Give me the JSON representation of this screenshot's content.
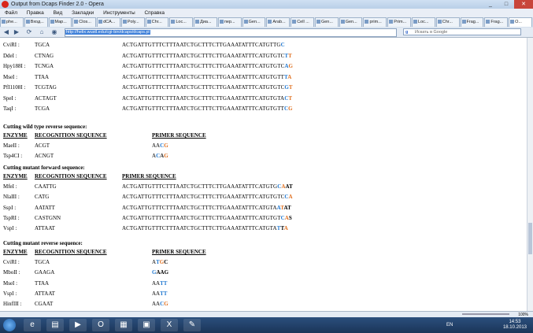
{
  "window": {
    "title": "Output from Dcaps Finder 2.0 - Opera",
    "minimize_glyph": "_",
    "maximize_glyph": "□",
    "close_glyph": "✕"
  },
  "menu": [
    "Файл",
    "Правка",
    "Вид",
    "Закладки",
    "Инструменты",
    "Справка"
  ],
  "tabs": [
    {
      "label": "phe..."
    },
    {
      "label": "Вход..."
    },
    {
      "label": "Map..."
    },
    {
      "label": "Clos..."
    },
    {
      "label": "dCA..."
    },
    {
      "label": "Poly..."
    },
    {
      "label": "Chr..."
    },
    {
      "label": "Loc..."
    },
    {
      "label": "Диа..."
    },
    {
      "label": "пер..."
    },
    {
      "label": "Gen..."
    },
    {
      "label": "Arab..."
    },
    {
      "label": "Cell ..."
    },
    {
      "label": "Gen..."
    },
    {
      "label": "Gen..."
    },
    {
      "label": "prim..."
    },
    {
      "label": "Prim..."
    },
    {
      "label": "Loc..."
    },
    {
      "label": "Chr..."
    },
    {
      "label": "Frag..."
    },
    {
      "label": "Frag..."
    },
    {
      "label": "O..."
    }
  ],
  "address": {
    "url": "http://helix.wustl.edu/cgi-bin/dcaps/dcaps.pl",
    "search_placeholder": "Искать в Google",
    "search_engine_glyph": "g"
  },
  "nav_glyphs": {
    "back": "◀",
    "forward": "▶",
    "reload": "⟳",
    "home": "⌂",
    "panel": "◉"
  },
  "top_rows": [
    {
      "enzyme": "CviRI :",
      "recognition": "TGCA",
      "primer_plain": "ACTGATTGTTTCTTTAATCTGCTTTCTTGAAATATTTCATGTTG",
      "primer_hl": [
        {
          "t": "C",
          "c": "#1f77d0"
        }
      ]
    },
    {
      "enzyme": "DdeI :",
      "recognition": "CTNAG",
      "primer_plain": "ACTGATTGTTTCTTTAATCTGCTTTCTTGAAATATTTCATGTGTC",
      "primer_hl": [
        {
          "t": "T",
          "c": "#1f77d0"
        },
        {
          "t": "T",
          "c": "#e07020"
        }
      ]
    },
    {
      "enzyme": "Hpy188I :",
      "recognition": "TCNGA",
      "primer_plain": "ACTGATTGTTTCTTTAATCTGCTTTCTTGAAATATTTCATGTGTC",
      "primer_hl": [
        {
          "t": "A",
          "c": "#1f77d0"
        },
        {
          "t": "G",
          "c": "#e07020"
        }
      ]
    },
    {
      "enzyme": "MseI :",
      "recognition": "TTAA",
      "primer_plain": "ACTGATTGTTTCTTTAATCTGCTTTCTTGAAATATTTCATGTGTT",
      "primer_hl": [
        {
          "t": "T",
          "c": "#1f77d0"
        },
        {
          "t": "A",
          "c": "#e07020"
        }
      ]
    },
    {
      "enzyme": "PfI1108I :",
      "recognition": "TCGTAG",
      "primer_plain": "ACTGATTGTTTCTTTAATCTGCTTTCTTGAAATATTTCATGTGTC",
      "primer_hl": [
        {
          "t": "G",
          "c": "#1f77d0"
        },
        {
          "t": "T",
          "c": "#e07020"
        }
      ]
    },
    {
      "enzyme": "SpeI :",
      "recognition": "ACTAGT",
      "primer_plain": "ACTGATTGTTTCTTTAATCTGCTTTCTTGAAATATTTCATGTGTA",
      "primer_hl": [
        {
          "t": "C",
          "c": "#1f77d0"
        },
        {
          "t": "T",
          "c": "#e07020"
        }
      ]
    },
    {
      "enzyme": "TaqI :",
      "recognition": "TCGA",
      "primer_plain": "ACTGATTGTTTCTTTAATCTGCTTTCTTGAAATATTTCATGTGTT",
      "primer_hl": [
        {
          "t": "C",
          "c": "#1f77d0"
        },
        {
          "t": "G",
          "c": "#e07020"
        }
      ]
    }
  ],
  "sections": {
    "wt_reverse": {
      "title": "Cutting wild type reverse sequence:",
      "h_enzyme": "ENZYME",
      "h_recognition": "RECOGNITION SEQUENCE",
      "h_primer": "PRIMER SEQUENCE",
      "rows": [
        {
          "enzyme": "MaeII :",
          "recognition": "ACGT",
          "primer_plain": "AA",
          "primer_hl": [
            {
              "t": "C",
              "c": "#1f77d0"
            },
            {
              "t": "G",
              "c": "#e07020"
            }
          ]
        },
        {
          "enzyme": "Tsp4CI :",
          "recognition": "ACNGT",
          "primer_plain": "A",
          "primer_hl": [
            {
              "t": "C",
              "c": "#1f77d0"
            },
            {
              "t": "A",
              "c": "#333"
            },
            {
              "t": "G",
              "c": "#e07020"
            }
          ]
        }
      ]
    },
    "mut_forward": {
      "title": "Cutting mutant forward sequence:",
      "h_enzyme": "ENZYME",
      "h_recognition": "RECOGNITION SEQUENCE",
      "h_primer": "PRIMER SEQUENCE",
      "rows": [
        {
          "enzyme": "MfeI :",
          "recognition": "CAATTG",
          "primer_plain": "ACTGATTGTTTCTTTAATCTGCTTTCTTGAAATATTTCATGTG",
          "primer_hl": [
            {
              "t": "C",
              "c": "#1f77d0"
            },
            {
              "t": "A",
              "c": "#e07020"
            },
            {
              "t": "AT",
              "c": "#000"
            }
          ]
        },
        {
          "enzyme": "NlaIII :",
          "recognition": "CATG",
          "primer_plain": "ACTGATTGTTTCTTTAATCTGCTTTCTTGAAATATTTCATGTGTC",
          "primer_hl": [
            {
              "t": "C",
              "c": "#1f77d0"
            },
            {
              "t": "A",
              "c": "#e07020"
            }
          ]
        },
        {
          "enzyme": "SspI :",
          "recognition": "AATATT",
          "primer_plain": "ACTGATTGTTTCTTTAATCTGCTTTCTTGAAATATTTCATGTA",
          "primer_hl": [
            {
              "t": "A",
              "c": "#1f77d0"
            },
            {
              "t": "T",
              "c": "#e07020"
            },
            {
              "t": "AT",
              "c": "#000"
            }
          ]
        },
        {
          "enzyme": "TspRI :",
          "recognition": "CASTGNN",
          "primer_plain": "ACTGATTGTTTCTTTAATCTGCTTTCTTGAAATATTTCATGTGT",
          "primer_hl": [
            {
              "t": "C",
              "c": "#1f77d0"
            },
            {
              "t": "A",
              "c": "#e07020"
            },
            {
              "t": "S",
              "c": "#000"
            }
          ]
        },
        {
          "enzyme": "VspI :",
          "recognition": "ATTAAT",
          "primer_plain": "ACTGATTGTTTCTTTAATCTGCTTTCTTGAAATATTTCATGTA",
          "primer_hl": [
            {
              "t": "T",
              "c": "#1f77d0"
            },
            {
              "t": "T",
              "c": "#000"
            },
            {
              "t": "A",
              "c": "#e07020"
            }
          ]
        }
      ]
    },
    "mut_reverse": {
      "title": "Cutting mutant reverse sequence:",
      "h_enzyme": "ENZYME",
      "h_recognition": "RECOGNITION SEQUENCE",
      "h_primer": "PRIMER SEQUENCE",
      "rows": [
        {
          "enzyme": "CviRI :",
          "recognition": "TGCA",
          "primer_plain": "A",
          "primer_hl": [
            {
              "t": "T",
              "c": "#1f77d0"
            },
            {
              "t": "G",
              "c": "#e07020"
            },
            {
              "t": "C",
              "c": "#000"
            }
          ]
        },
        {
          "enzyme": "MboII :",
          "recognition": "GAAGA",
          "primer_plain": "",
          "primer_hl": [
            {
              "t": "G",
              "c": "#1f77d0"
            },
            {
              "t": "AAG",
              "c": "#000"
            }
          ]
        },
        {
          "enzyme": "MseI :",
          "recognition": "TTAA",
          "primer_plain": "AA",
          "primer_hl": [
            {
              "t": "T",
              "c": "#1f77d0"
            },
            {
              "t": "T",
              "c": "#1f77d0"
            }
          ]
        },
        {
          "enzyme": "VspI :",
          "recognition": "ATTAAT",
          "primer_plain": "AA",
          "primer_hl": [
            {
              "t": "T",
              "c": "#1f77d0"
            },
            {
              "t": "T",
              "c": "#1f77d0"
            }
          ]
        },
        {
          "enzyme": "HinfIII :",
          "recognition": "CGAAT",
          "primer_plain": "AA",
          "primer_hl": [
            {
              "t": "C",
              "c": "#1f77d0"
            },
            {
              "t": "G",
              "c": "#e07020"
            }
          ]
        }
      ]
    }
  },
  "taskbar": {
    "lang": "EN",
    "time": "14:53",
    "date": "18.10.2013",
    "apps": [
      {
        "name": "ie",
        "glyph": "e"
      },
      {
        "name": "explorer",
        "glyph": "▤"
      },
      {
        "name": "media",
        "glyph": "▶"
      },
      {
        "name": "opera",
        "glyph": "O"
      },
      {
        "name": "app-red",
        "glyph": "▦"
      },
      {
        "name": "app-blue",
        "glyph": "▣"
      },
      {
        "name": "excel",
        "glyph": "X"
      },
      {
        "name": "paint",
        "glyph": "✎"
      }
    ]
  },
  "statusbar": {
    "zoom_label": "100%"
  }
}
